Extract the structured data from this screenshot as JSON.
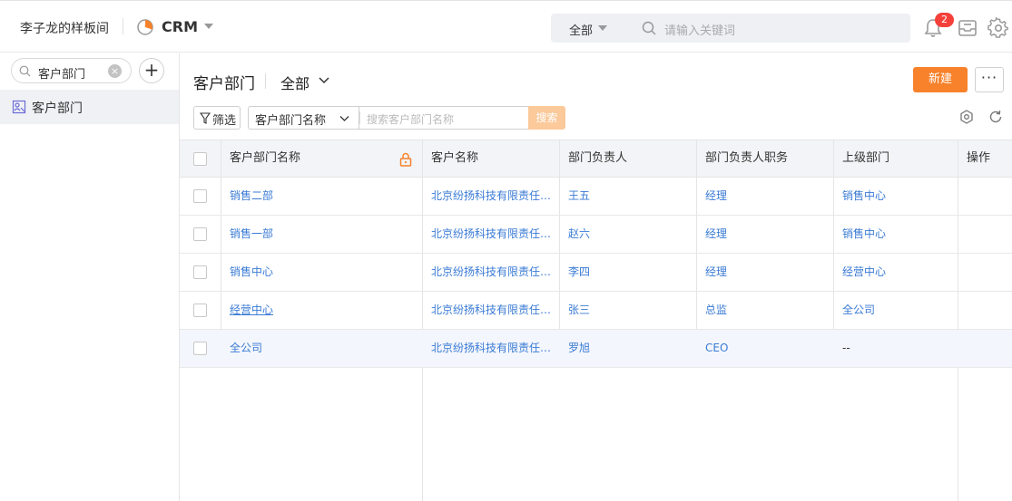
{
  "header": {
    "workspace": "李子龙的样板间",
    "app_name": "CRM",
    "search_scope": "全部",
    "search_placeholder": "请输入关键词",
    "notification_count": "2"
  },
  "sidebar": {
    "search_value": "客户部门",
    "items": [
      {
        "label": "客户部门",
        "icon": "org-structure-icon"
      }
    ]
  },
  "main": {
    "title": "客户部门",
    "view": "全部",
    "new_button": "新建",
    "more_button": "···",
    "filter_button": "筛选",
    "search_field": "客户部门名称",
    "search_placeholder": "搜索客户部门名称",
    "search_button": "搜索"
  },
  "table": {
    "columns": [
      "客户部门名称",
      "客户名称",
      "部门负责人",
      "部门负责人职务",
      "上级部门",
      "操作"
    ],
    "rows": [
      [
        "销售二部",
        "北京纷扬科技有限责任公司",
        "王五",
        "经理",
        "销售中心",
        ""
      ],
      [
        "销售一部",
        "北京纷扬科技有限责任公司",
        "赵六",
        "经理",
        "销售中心",
        ""
      ],
      [
        "销售中心",
        "北京纷扬科技有限责任公司",
        "李四",
        "经理",
        "经营中心",
        ""
      ],
      [
        "经营中心",
        "北京纷扬科技有限责任公司",
        "张三",
        "总监",
        "全公司",
        ""
      ],
      [
        "全公司",
        "北京纷扬科技有限责任公司",
        "罗旭",
        "CEO",
        "--",
        ""
      ]
    ]
  },
  "colors": {
    "accent": "#f7822b",
    "link": "#3a7bd5",
    "badge": "#f5403a"
  }
}
